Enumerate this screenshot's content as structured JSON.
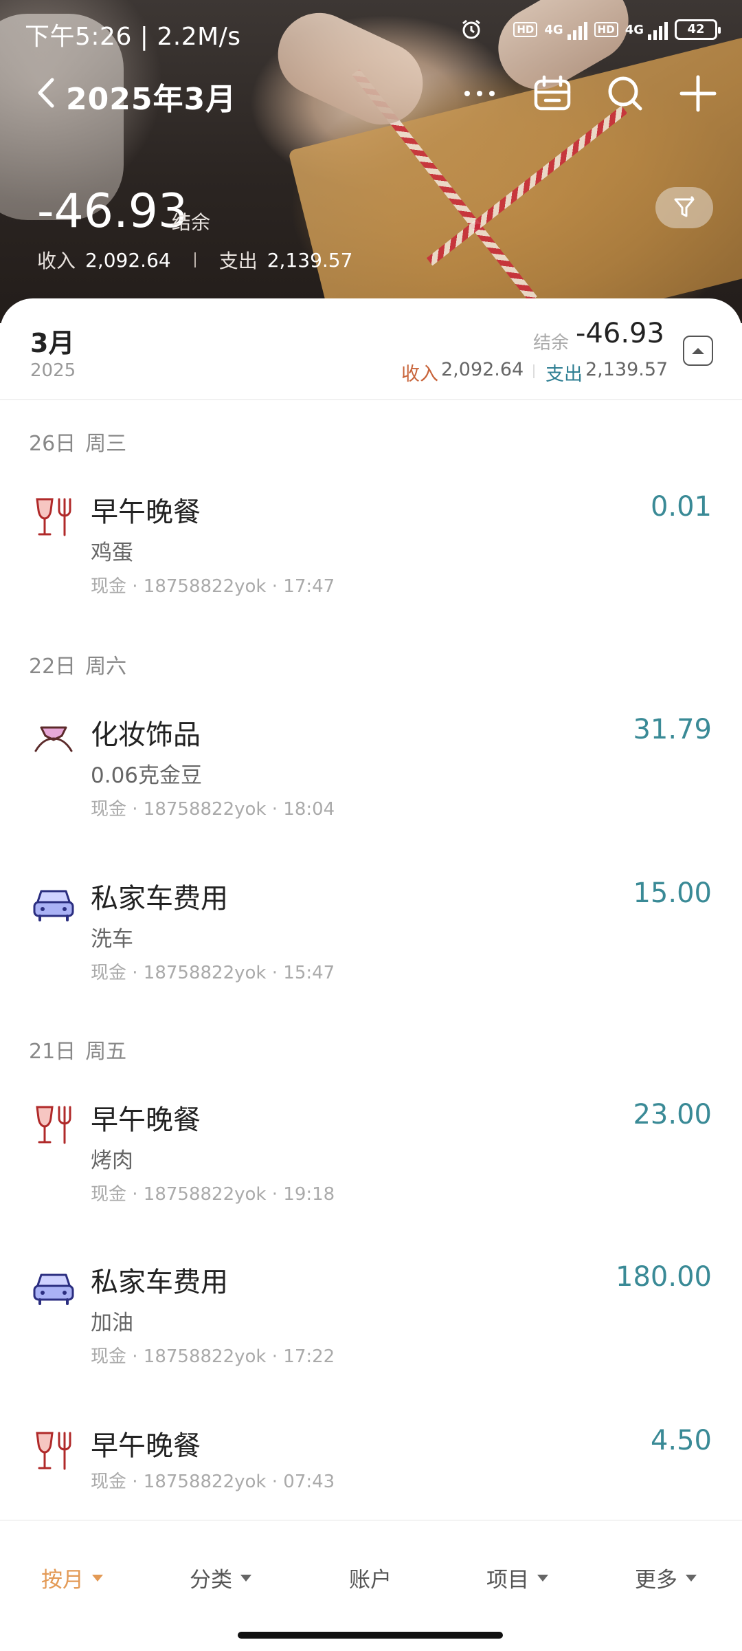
{
  "status_bar": {
    "time": "下午5:26 | 2.2M/s",
    "hd": "HD",
    "network": "4G",
    "battery": "42"
  },
  "header": {
    "title": "2025年3月",
    "balance": "-46.93",
    "balance_label": "结余",
    "income_label": "收入",
    "income": "2,092.64",
    "expense_label": "支出",
    "expense": "2,139.57"
  },
  "month_summary": {
    "month": "3月",
    "year": "2025",
    "balance_label": "结余",
    "balance": "-46.93",
    "income_label": "收入",
    "income": "2,092.64",
    "expense_label": "支出",
    "expense": "2,139.57"
  },
  "days": [
    {
      "date": "26日",
      "weekday": "周三",
      "transactions": [
        {
          "icon": "wine-fork-icon",
          "category": "早午晚餐",
          "note": "鸡蛋",
          "meta": "现金 · 18758822yok · 17:47",
          "amount": "0.01"
        }
      ]
    },
    {
      "date": "22日",
      "weekday": "周六",
      "transactions": [
        {
          "icon": "diamond-ring-icon",
          "category": "化妆饰品",
          "note": "0.06克金豆",
          "meta": "现金 · 18758822yok · 18:04",
          "amount": "31.79"
        },
        {
          "icon": "car-icon",
          "category": "私家车费用",
          "note": "洗车",
          "meta": "现金 · 18758822yok · 15:47",
          "amount": "15.00"
        }
      ]
    },
    {
      "date": "21日",
      "weekday": "周五",
      "transactions": [
        {
          "icon": "wine-fork-icon",
          "category": "早午晚餐",
          "note": "烤肉",
          "meta": "现金 · 18758822yok · 19:18",
          "amount": "23.00"
        },
        {
          "icon": "car-icon",
          "category": "私家车费用",
          "note": "加油",
          "meta": "现金 · 18758822yok · 17:22",
          "amount": "180.00"
        },
        {
          "icon": "wine-fork-icon",
          "category": "早午晚餐",
          "note": "",
          "meta": "现金 · 18758822yok · 07:43",
          "amount": "4.50"
        }
      ]
    }
  ],
  "bottom_bar": {
    "items": [
      "按月",
      "分类",
      "账户",
      "项目",
      "更多"
    ]
  },
  "colors": {
    "income": "#c8643a",
    "expense": "#2f7f93",
    "amount": "#3a8a96",
    "active_tab": "#e39a56"
  }
}
